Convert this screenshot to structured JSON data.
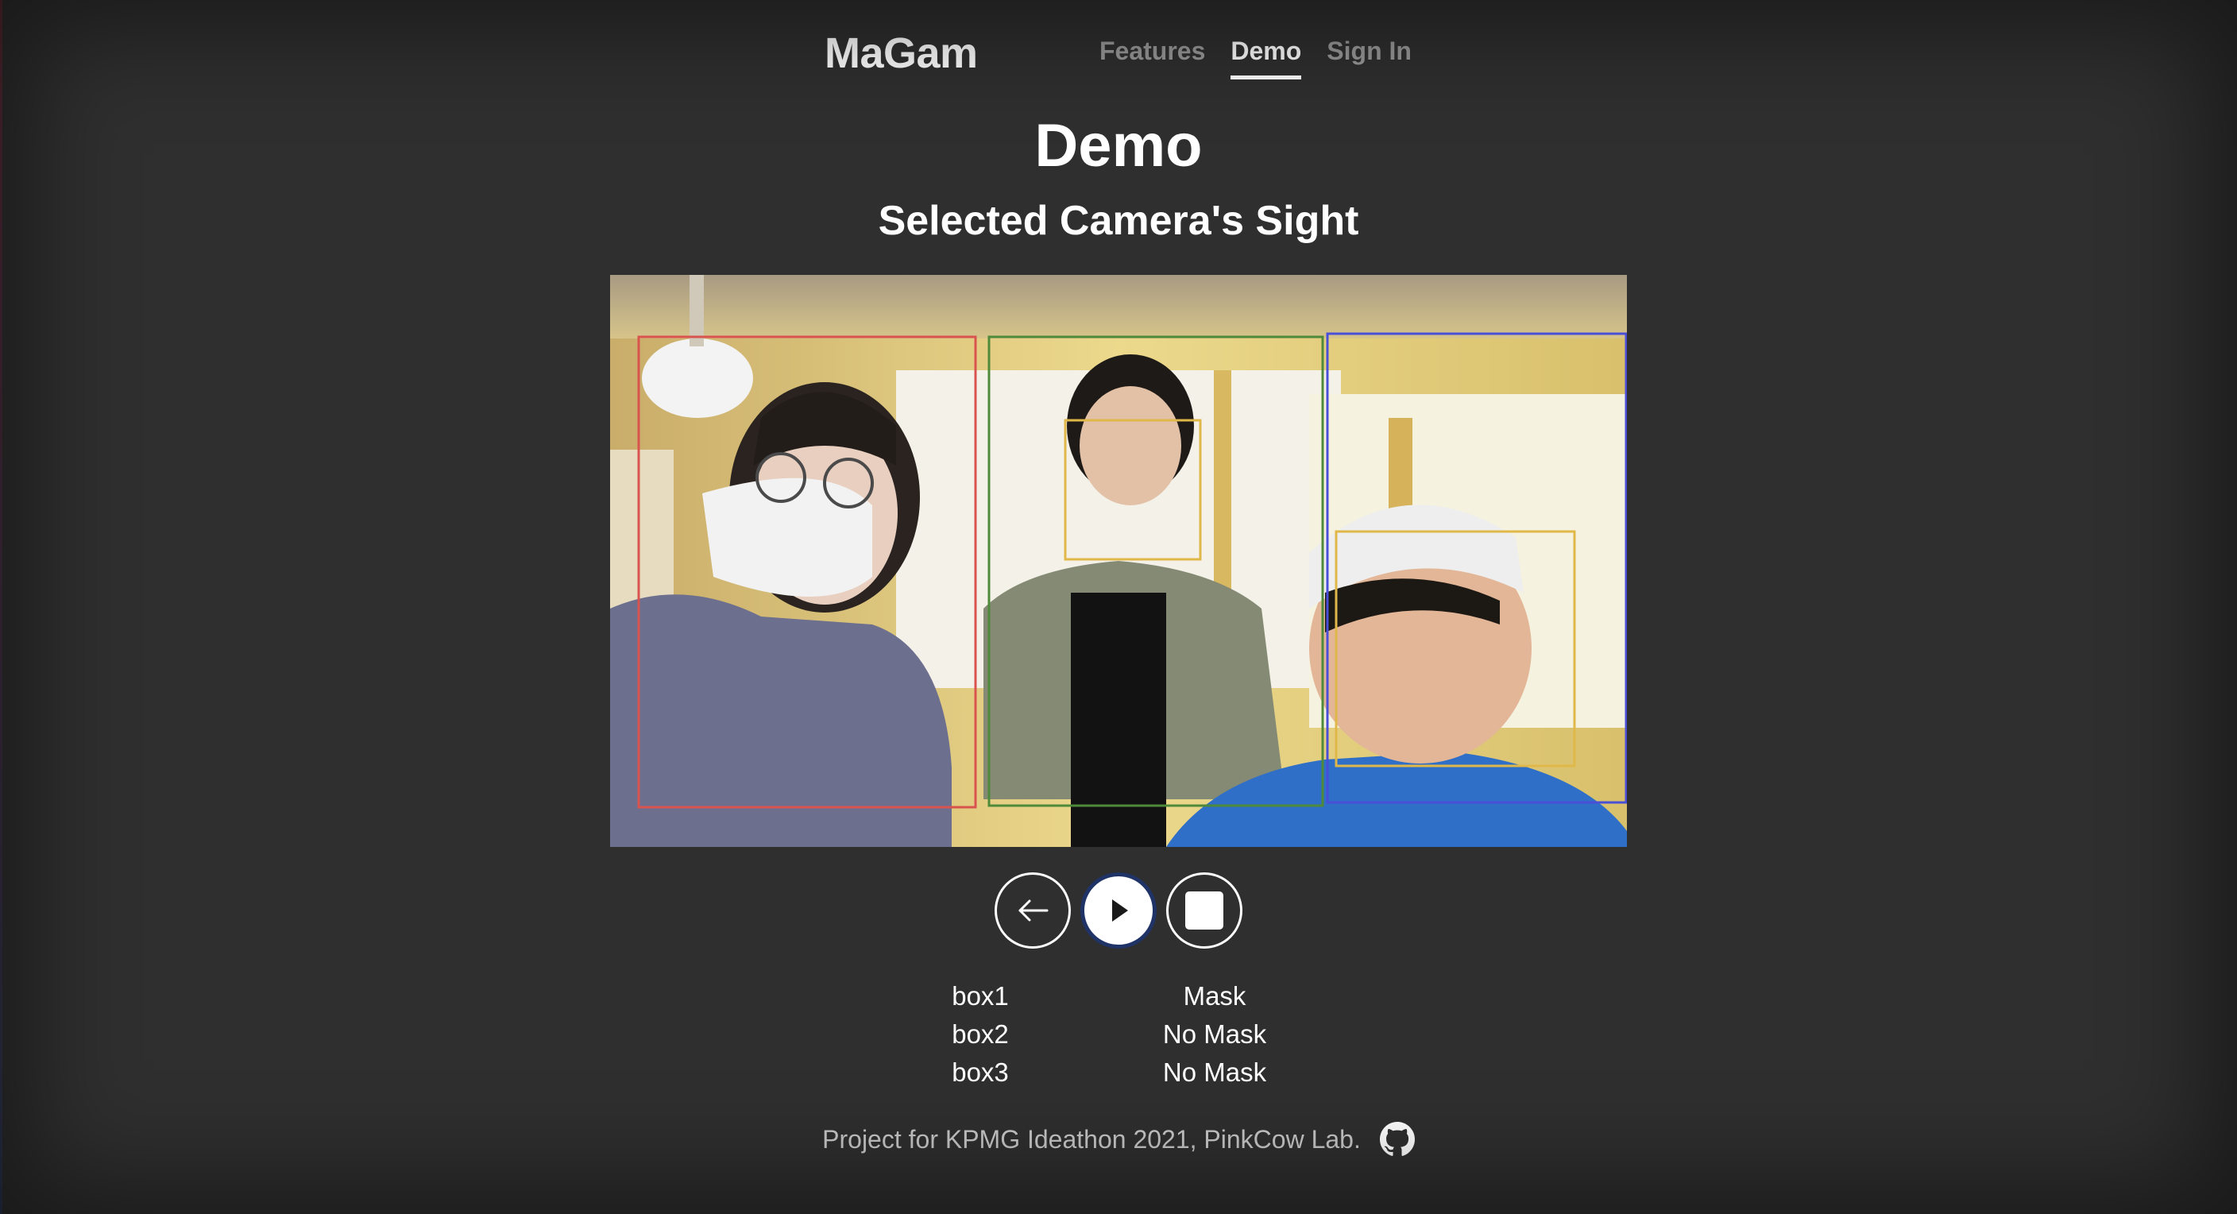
{
  "nav": {
    "brand": "MaGam",
    "links": [
      {
        "label": "Features"
      },
      {
        "label": "Demo"
      },
      {
        "label": "Sign In"
      }
    ]
  },
  "page": {
    "title": "Demo",
    "subtitle": "Selected Camera's Sight"
  },
  "camera": {
    "boxes": [
      {
        "id": "box1",
        "color": "#d9534f"
      },
      {
        "id": "box2",
        "color": "#4f8a3a"
      },
      {
        "id": "box3",
        "color": "#4a4fd8"
      }
    ],
    "face_box_color": "#e0b84a"
  },
  "controls": {
    "back_icon": "arrow-left-icon",
    "play_icon": "play-icon",
    "stop_icon": "stop-icon"
  },
  "status": {
    "rows": [
      {
        "box": "box1",
        "mask": "Mask"
      },
      {
        "box": "box2",
        "mask": "No Mask"
      },
      {
        "box": "box3",
        "mask": "No Mask"
      }
    ]
  },
  "footer": {
    "text": "Project for KPMG Ideathon 2021, PinkCow Lab.",
    "icon": "github-icon"
  }
}
